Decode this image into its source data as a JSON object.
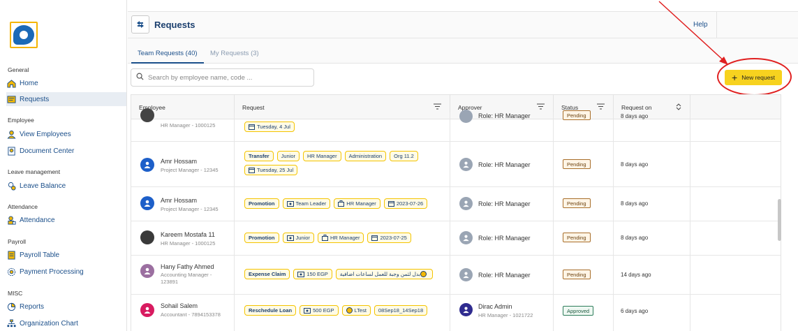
{
  "sidebar": {
    "sections": {
      "general": "General",
      "employee": "Employee",
      "leave": "Leave management",
      "attendance": "Attendance",
      "payroll": "Payroll",
      "misc": "MISC"
    },
    "items": {
      "home": "Home",
      "requests": "Requests",
      "view_employees": "View Employees",
      "document_center": "Document Center",
      "leave_balance": "Leave Balance",
      "attendance": "Attendance",
      "payroll_table": "Payroll Table",
      "payment_processing": "Payment Processing",
      "reports": "Reports",
      "org_chart": "Organization Chart"
    }
  },
  "header": {
    "title": "Requests",
    "help": "Help"
  },
  "tabs": {
    "team": "Team Requests (40)",
    "my": "My Requests (3)"
  },
  "search": {
    "placeholder": "Search by employee name, code ..."
  },
  "new_request": "New request",
  "columns": {
    "employee": "Employee",
    "request": "Request",
    "approver": "Approver",
    "status": "Status",
    "request_on": "Request on"
  },
  "rows": [
    {
      "name": "",
      "sub": "HR Manager - 1000125",
      "chips": [
        "Tuesday, 4 Jul"
      ],
      "approver": "Role: HR Manager",
      "status": "Pending",
      "requested": "8 days ago"
    },
    {
      "name": "Amr Hossam",
      "sub": "Project Manager - 12345",
      "chips": [
        "Transfer",
        "Junior",
        "HR Manager",
        "Administration",
        "Org 11.2",
        "Tuesday, 25 Jul"
      ],
      "approver": "Role: HR Manager",
      "status": "Pending",
      "requested": "8 days ago"
    },
    {
      "name": "Amr Hossam",
      "sub": "Project Manager - 12345",
      "chips": [
        "Promotion",
        "Team Leader",
        "HR Manager",
        "2023-07-26"
      ],
      "approver": "Role: HR Manager",
      "status": "Pending",
      "requested": "8 days ago"
    },
    {
      "name": "Kareem Mostafa 11",
      "sub": "HR Manager - 1000125",
      "chips": [
        "Promotion",
        "Junior",
        "HR Manager",
        "2023-07-25"
      ],
      "approver": "Role: HR Manager",
      "status": "Pending",
      "requested": "8 days ago"
    },
    {
      "name": "Hany Fathy Ahmed",
      "sub": "Accounting Manager - 123891",
      "chips": [
        "Expense Claim",
        "150 EGP",
        "بدل لثمن وجبة للعمل لساعات اضافية"
      ],
      "approver": "Role: HR Manager",
      "status": "Pending",
      "requested": "14 days ago"
    },
    {
      "name": "Sohail Salem",
      "sub": "Accountant - 7894153378",
      "chips": [
        "Reschedule Loan",
        "500 EGP",
        "LTest",
        "08Sep18_14Sep18"
      ],
      "approver": "Dirac Admin",
      "approver_sub": "HR Manager - 1021722",
      "status": "Approved",
      "requested": "6 days ago"
    }
  ]
}
